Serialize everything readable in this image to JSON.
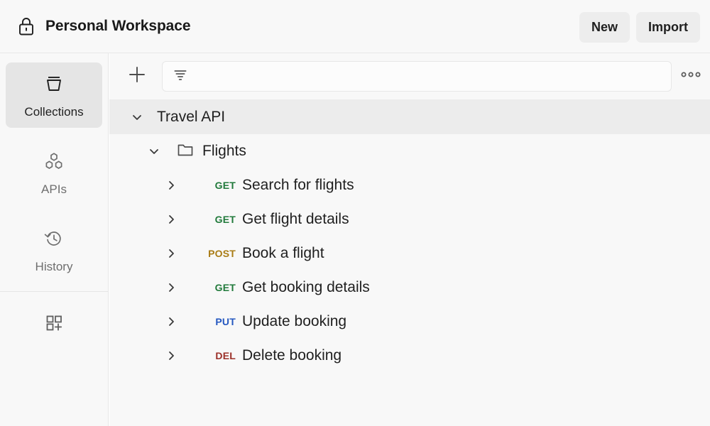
{
  "header": {
    "lock_icon": "lock-icon",
    "workspace_title": "Personal Workspace",
    "new_label": "New",
    "import_label": "Import"
  },
  "rail": {
    "items": [
      {
        "label": "Collections",
        "icon": "collection-icon",
        "active": true
      },
      {
        "label": "APIs",
        "icon": "apis-hexagon-icon",
        "active": false
      },
      {
        "label": "History",
        "icon": "history-clock-icon",
        "active": false
      }
    ],
    "add_module_icon": "add-modules-icon"
  },
  "toolbar": {
    "add_icon": "plus-icon",
    "filter_icon": "filter-icon",
    "search_value": "",
    "search_placeholder": "",
    "more_icon": "more-horizontal-icon"
  },
  "tree": {
    "collection": {
      "name": "Travel API",
      "chevron": "chevron-down-icon",
      "expanded": true
    },
    "folder": {
      "name": "Flights",
      "chevron": "chevron-down-icon",
      "icon": "folder-icon",
      "expanded": true
    },
    "requests": [
      {
        "method": "GET",
        "name": "Search for flights",
        "chevron": "chevron-right-icon"
      },
      {
        "method": "GET",
        "name": "Get flight details",
        "chevron": "chevron-right-icon"
      },
      {
        "method": "POST",
        "name": "Book a flight",
        "chevron": "chevron-right-icon"
      },
      {
        "method": "GET",
        "name": "Get booking details",
        "chevron": "chevron-right-icon"
      },
      {
        "method": "PUT",
        "name": "Update booking",
        "chevron": "chevron-right-icon"
      },
      {
        "method": "DEL",
        "name": "Delete booking",
        "chevron": "chevron-right-icon"
      }
    ]
  },
  "colors": {
    "get": "#1d7а3c",
    "method_get": "#217a3b",
    "method_post": "#a97c15",
    "method_put": "#2558c0",
    "method_del": "#9b2f28",
    "header_bg": "#f8f8f8",
    "active_rail_bg": "#e5e5e5",
    "collection_row_bg": "#ececec",
    "text_primary": "#1f1f1f",
    "text_muted": "#6e6e6e"
  }
}
